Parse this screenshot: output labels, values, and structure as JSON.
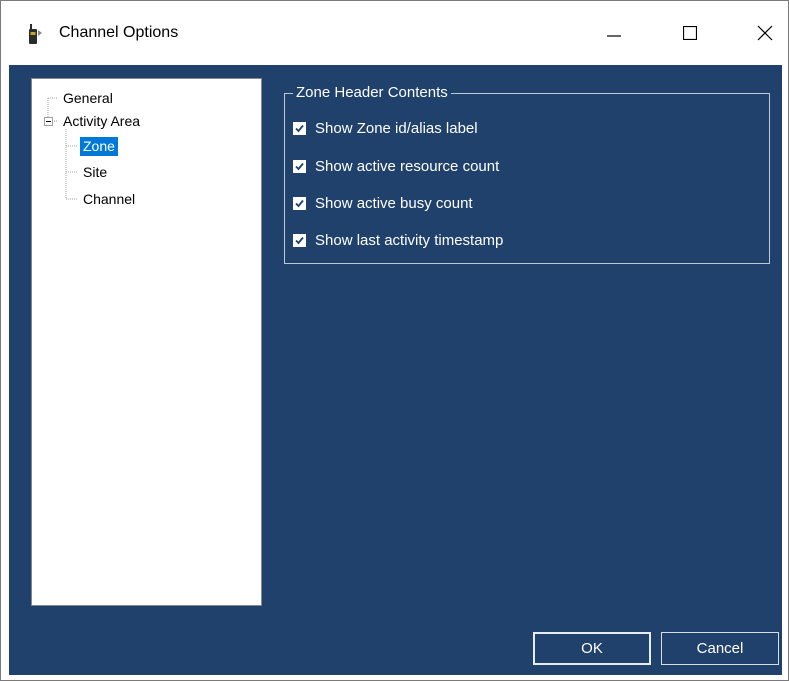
{
  "window": {
    "title": "Channel Options",
    "icon": "handheld-radio-icon"
  },
  "titlebar_controls": {
    "minimize": "minimize-icon",
    "maximize": "maximize-icon",
    "close": "close-icon"
  },
  "tree": {
    "items": [
      {
        "label": "General",
        "level": 0,
        "selected": false
      },
      {
        "label": "Activity Area",
        "level": 0,
        "expanded": true,
        "selected": false
      },
      {
        "label": "Zone",
        "level": 1,
        "selected": true
      },
      {
        "label": "Site",
        "level": 1,
        "selected": false
      },
      {
        "label": "Channel",
        "level": 1,
        "selected": false
      }
    ]
  },
  "zone_header": {
    "title": "Zone Header Contents",
    "options": [
      {
        "label": "Show Zone id/alias label",
        "checked": true
      },
      {
        "label": "Show active resource count",
        "checked": true
      },
      {
        "label": "Show active busy count",
        "checked": true
      },
      {
        "label": "Show last activity timestamp",
        "checked": true
      }
    ]
  },
  "buttons": {
    "ok": "OK",
    "cancel": "Cancel"
  },
  "colors": {
    "client_background": "#1f416b",
    "selection": "#0078d7"
  }
}
